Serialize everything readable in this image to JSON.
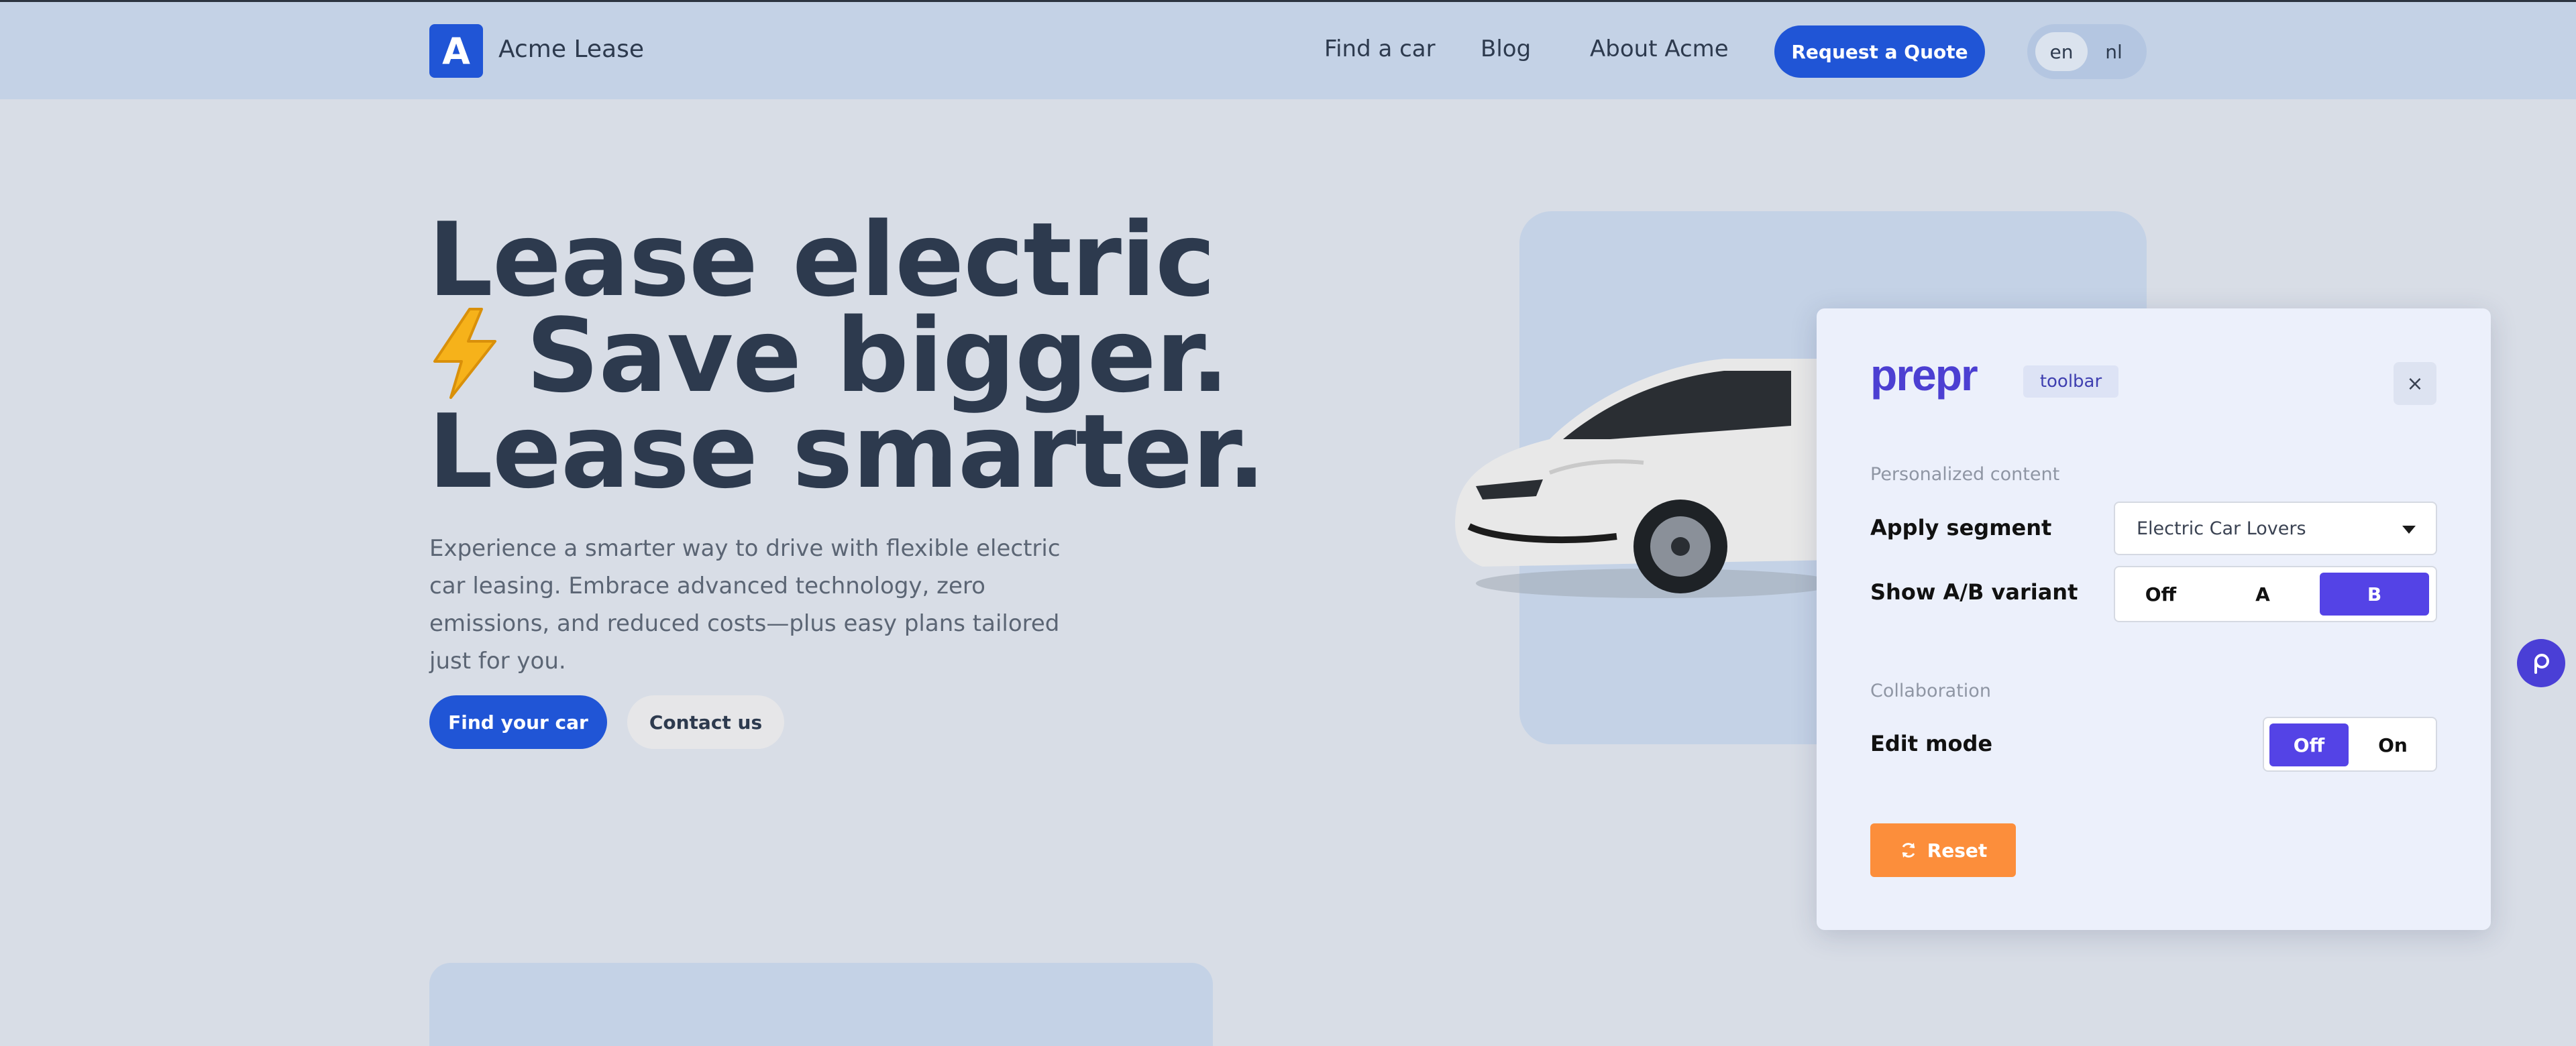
{
  "header": {
    "logo_letter": "A",
    "brand": "Acme Lease",
    "nav": [
      "Find a car",
      "Blog",
      "About Acme"
    ],
    "quote_button": "Request a Quote",
    "languages": [
      "en",
      "nl"
    ],
    "active_language": "en",
    "accent_color": "#2055d6"
  },
  "hero": {
    "line1": "Lease electric",
    "line2": "Save bigger.",
    "line3": "Lease smarter.",
    "bolt_icon": "lightning-bolt-icon",
    "description": "Experience a smarter way to drive with flexible electric car leasing. Embrace advanced technology, zero emissions, and reduced costs—plus easy plans tailored just for you.",
    "primary_button": "Find your car",
    "secondary_button": "Contact us"
  },
  "toolbar": {
    "logo_text": "prepr",
    "tag": "toolbar",
    "close": "×",
    "personalized_label": "Personalized content",
    "apply_segment_label": "Apply segment",
    "segment_value": "Electric Car Lovers",
    "ab_label": "Show A/B variant",
    "ab_options": [
      "Off",
      "A",
      "B"
    ],
    "ab_selected": "B",
    "collaboration_label": "Collaboration",
    "edit_mode_label": "Edit mode",
    "edit_options": [
      "Off",
      "On"
    ],
    "edit_selected": "Off",
    "reset_button": "Reset",
    "active_color": "#5443e6",
    "reset_color": "#fc8e3b"
  }
}
